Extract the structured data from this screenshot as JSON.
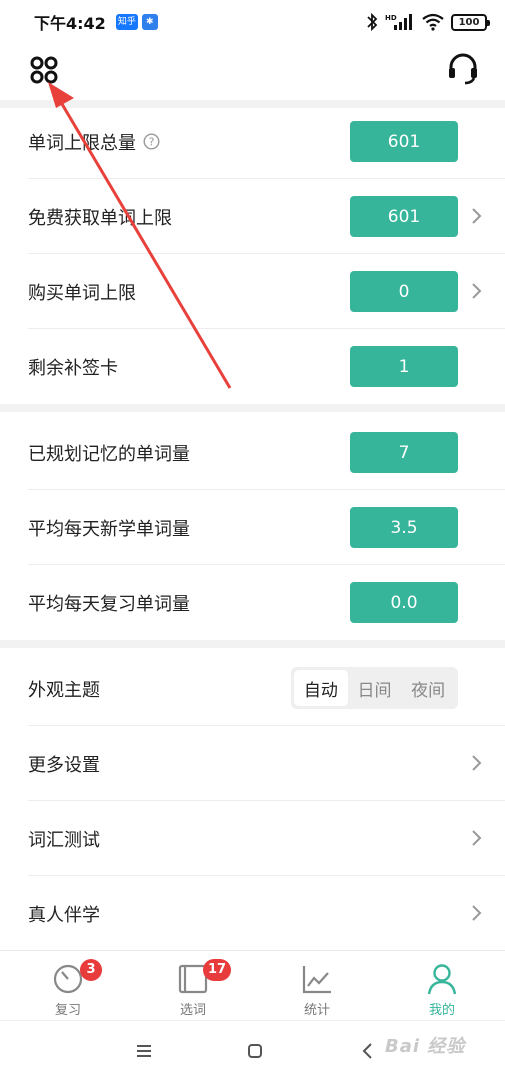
{
  "status_bar": {
    "time": "下午4:42",
    "chip_app": "知乎",
    "network": "HD",
    "battery": "100"
  },
  "settings": {
    "group1": [
      {
        "label": "单词上限总量",
        "value": "601",
        "has_help": true,
        "has_chevron": false
      },
      {
        "label": "免费获取单词上限",
        "value": "601",
        "has_help": false,
        "has_chevron": true
      },
      {
        "label": "购买单词上限",
        "value": "0",
        "has_help": false,
        "has_chevron": true
      },
      {
        "label": "剩余补签卡",
        "value": "1",
        "has_help": false,
        "has_chevron": false
      }
    ],
    "group2": [
      {
        "label": "已规划记忆的单词量",
        "value": "7"
      },
      {
        "label": "平均每天新学单词量",
        "value": "3.5"
      },
      {
        "label": "平均每天复习单词量",
        "value": "0.0"
      }
    ],
    "theme": {
      "label": "外观主题",
      "options": [
        "自动",
        "日间",
        "夜间"
      ],
      "selected": "自动"
    },
    "links": [
      {
        "label": "更多设置"
      },
      {
        "label": "词汇测试"
      },
      {
        "label": "真人伴学"
      }
    ]
  },
  "bottom_nav": [
    {
      "label": "复习",
      "badge": "3",
      "active": false
    },
    {
      "label": "选词",
      "badge": "17",
      "active": false
    },
    {
      "label": "统计",
      "badge": "",
      "active": false
    },
    {
      "label": "我的",
      "badge": "",
      "active": true
    }
  ],
  "watermark": "Bai 经验",
  "colors": {
    "accent": "#36b59a",
    "badge": "#e83b3b",
    "annotation": "#e8403a"
  }
}
